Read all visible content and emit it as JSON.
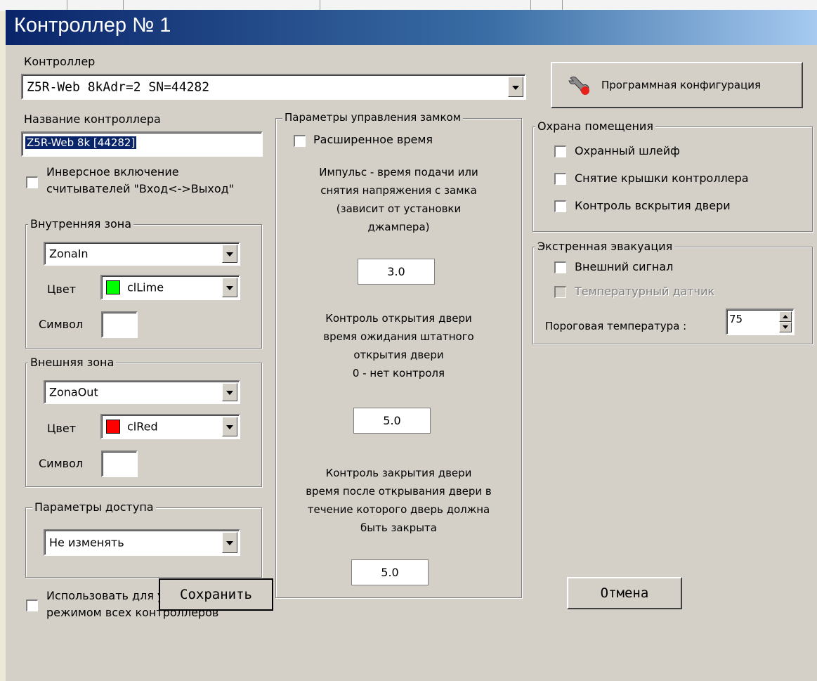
{
  "window": {
    "title": "Контроллер № 1"
  },
  "colors": {
    "titlebar_start": "#0a246a",
    "face": "#d4d0c8",
    "lime": "#00ff00",
    "red": "#ff0000",
    "selection": "#0a246a"
  },
  "controller": {
    "label": "Контроллер",
    "selected": "Z5R-Web 8kAdr=2 SN=44282"
  },
  "prog_config_button": {
    "label": "Программная конфигурация",
    "icon": "wrench-icon"
  },
  "name": {
    "label": "Название контроллера",
    "value": "Z5R-Web 8k [44282]"
  },
  "inverse_readers": {
    "label_line1": "Инверсное включение",
    "label_line2": "считывателей \"Вход<->Выход\"",
    "checked": false
  },
  "inner_zone": {
    "title": "Внутренняя зона",
    "zone": "ZonaIn",
    "color_label": "Цвет",
    "color_value": "clLime",
    "symbol_label": "Символ",
    "symbol_value": ""
  },
  "outer_zone": {
    "title": "Внешняя зона",
    "zone": "ZonaOut",
    "color_label": "Цвет",
    "color_value": "clRed",
    "symbol_label": "Символ",
    "symbol_value": ""
  },
  "access": {
    "title": "Параметры доступа",
    "value": "Не изменять"
  },
  "use_for_all": {
    "label_line1": "Использовать для управления",
    "label_line2": "режимом всех контроллеров",
    "checked": false
  },
  "lock": {
    "title": "Параметры управления замком",
    "extended_time": {
      "label": "Расширенное время",
      "checked": false
    },
    "pulse_desc": [
      "Импульс - время подачи или",
      "снятия напряжения с замка",
      "(зависит от установки",
      "джампера)"
    ],
    "pulse_value": "3.0",
    "open_desc": [
      "Контроль открытия двери",
      "время ожидания штатного",
      "открытия двери",
      "0 - нет контроля"
    ],
    "open_value": "5.0",
    "close_desc": [
      "Контроль закрытия двери",
      "время после открывания двери в",
      "течение которого дверь должна",
      "быть закрыта"
    ],
    "close_value": "5.0"
  },
  "security": {
    "title": "Охрана помещения",
    "items": [
      {
        "label": "Охранный шлейф",
        "checked": false
      },
      {
        "label": "Снятие крышки контроллера",
        "checked": false
      },
      {
        "label": "Контроль вскрытия двери",
        "checked": false
      }
    ]
  },
  "evacuation": {
    "title": "Экстренная эвакуация",
    "external": {
      "label": "Внешний сигнал",
      "checked": false
    },
    "temp_sensor": {
      "label": "Температурный датчик",
      "checked": false,
      "disabled": true
    },
    "threshold_label": "Пороговая температура :",
    "threshold_value": "75"
  },
  "buttons": {
    "save": "Сохранить",
    "cancel": "Отмена"
  }
}
